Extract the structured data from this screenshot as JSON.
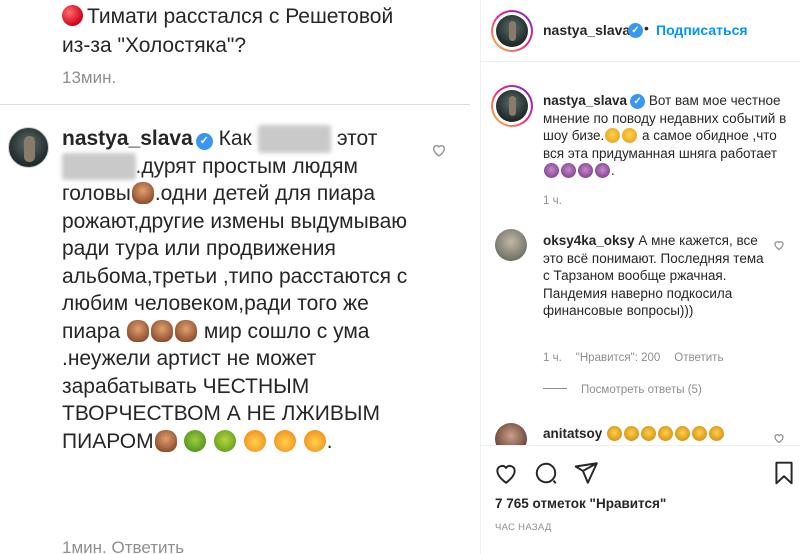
{
  "left": {
    "prev_comment_line1": "Тимати расстался с Решетовой",
    "prev_comment_line2": "из-за \"Холостяка\"?",
    "prev_time": "13мин.",
    "username": "nastya_slava",
    "comment_part1": "Как",
    "comment_part2": "этот",
    "comment_part3": ".дурят простым людям головы",
    "comment_part4": ".одни детей для пиара рожают,другие измены выдумываю ради тура или продвижения альбома,третьи ,типо расстаются с любим человеком,ради того же пиара",
    "comment_part5": "мир сошло с ума .неужели артист не может зарабатывать ЧЕСТНЫМ ТВОРЧЕСТВОМ А НЕ ЛЖИВЫМ ПИАРОМ",
    "comment_part6": ".",
    "bottom_meta": "1мин. Ответить"
  },
  "post": {
    "header": {
      "username": "nastya_slava",
      "dot": "•",
      "follow_label": "Подписаться"
    },
    "caption": {
      "username": "nastya_slava",
      "text_part1": "Вот вам мое честное мнение по поводу недавних событий в шоу бизе.",
      "text_part2": "а самое обидное ,что вся эта придуманная шняга работает",
      "text_part3": ".",
      "time": "1 ч."
    },
    "comments": [
      {
        "username": "oksy4ka_oksy",
        "text": "А мне кажется, все это всё понимают. Последняя тема с Тарзаном вообще ржачная. Пандемия наверно подкосила финансовые вопросы)))",
        "time": "1 ч.",
        "likes": "\"Нравится\": 200",
        "reply": "Ответить"
      },
      {
        "username": "anitatsoy",
        "text": ""
      }
    ],
    "view_replies": "Посмотреть ответы (5)",
    "likes_count": "7 765 отметок \"Нравится\"",
    "time_ago": "ЧАС НАЗАД"
  },
  "icons": [
    "red-circle-icon",
    "verified-icon",
    "heart-icon",
    "comment-icon",
    "share-icon",
    "bookmark-icon"
  ],
  "colors": {
    "accent": "#0095f6",
    "verified": "#3897f0",
    "muted": "#8e8e8e",
    "text": "#262626"
  }
}
